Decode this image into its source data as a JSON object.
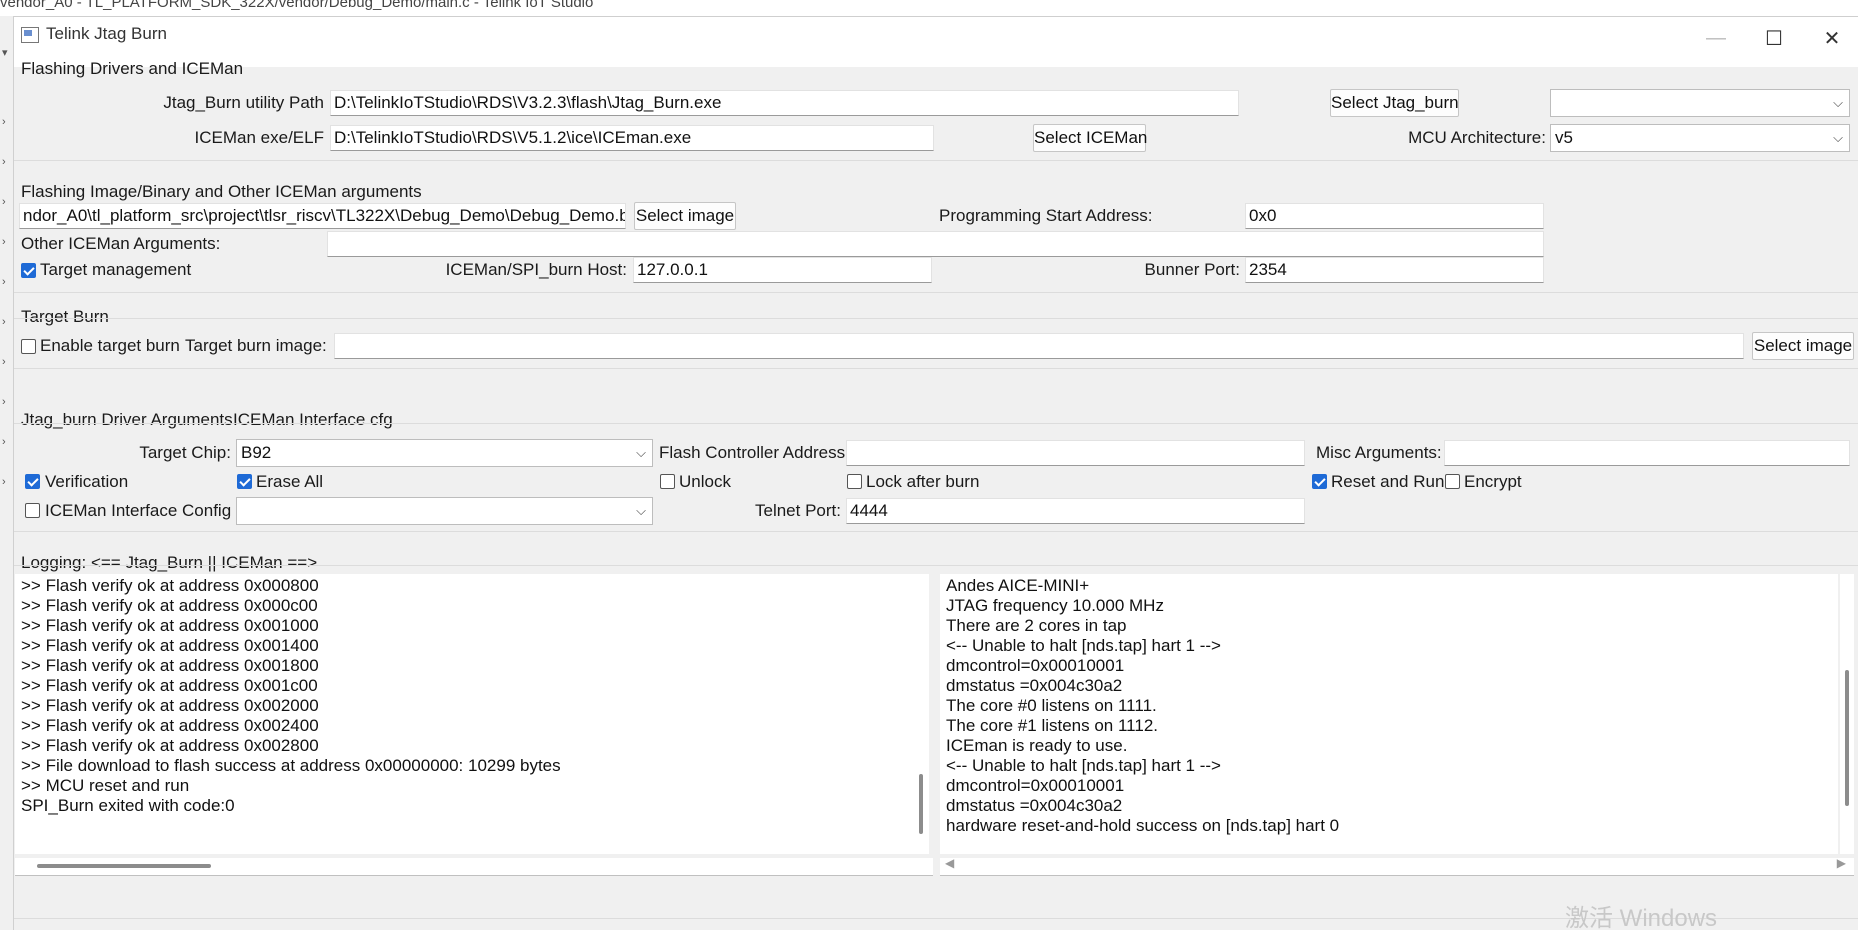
{
  "background_path": "vendor_A0 - TL_PLATFORM_SDK_322X/vendor/Debug_Demo/main.c - Telink IoT Studio",
  "window": {
    "title": "Telink Jtag Burn",
    "minimize_glyph": "—",
    "maximize_glyph": "☐",
    "close_glyph": "✕"
  },
  "flashing_drivers": {
    "section_title": "Flashing Drivers and ICEMan",
    "jtag_burn_path_label": "Jtag_Burn utility Path",
    "jtag_burn_path_value": "D:\\TelinkIoTStudio\\RDS\\V3.2.3\\flash\\Jtag_Burn.exe",
    "select_jtag_burn_label": "Select Jtag_burn",
    "top_right_combo_value": "",
    "iceman_label": "ICEMan exe/ELF",
    "iceman_value": "D:\\TelinkIoTStudio\\RDS\\V5.1.2\\ice\\ICEman.exe",
    "select_iceman_label": "Select ICEMan",
    "mcu_arch_label": "MCU Architecture:",
    "mcu_arch_value": "v5"
  },
  "flashing_image": {
    "section_title": "Flashing Image/Binary and Other ICEMan arguments",
    "image_path_value": "ndor_A0\\tl_platform_src\\project\\tlsr_riscv\\TL322X\\Debug_Demo\\Debug_Demo.bin",
    "select_image_label": "Select image",
    "start_address_label": "Programming Start Address:",
    "start_address_value": "0x0",
    "other_args_label": "Other ICEMan Arguments:",
    "other_args_value": "",
    "target_management_label": "Target management",
    "target_management_checked": true,
    "host_label": "ICEMan/SPI_burn Host:",
    "host_value": "127.0.0.1",
    "port_label": "Bunner Port:",
    "port_value": "2354"
  },
  "target_burn": {
    "section_title": "Target Burn",
    "enable_label": "Enable target burn",
    "enable_checked": false,
    "image_label": "Target burn image:",
    "image_value": "",
    "select_image_label": "Select image"
  },
  "driver_args": {
    "tab_jtag": "Jtag_burn Driver Arguments",
    "tab_iceman": "ICEMan Interface cfg",
    "target_chip_label": "Target Chip:",
    "target_chip_value": "B92",
    "flash_ctrl_label": "Flash Controller Address:",
    "flash_ctrl_value": "",
    "misc_label": "Misc Arguments:",
    "misc_value": "",
    "verification_label": "Verification",
    "erase_all_label": "Erase All",
    "unlock_label": "Unlock",
    "lock_after_label": "Lock after burn",
    "reset_run_label": "Reset and Run",
    "encrypt_label": "Encrypt",
    "iceman_cfg_label": "ICEMan Interface Config :",
    "iceman_cfg_value": "",
    "telnet_label": "Telnet Port:",
    "telnet_value": "4444",
    "checks": {
      "verification": true,
      "erase_all": true,
      "unlock": false,
      "lock_after": false,
      "reset_run": true,
      "encrypt": false,
      "iceman_cfg": false
    }
  },
  "logging": {
    "title": "Logging: <== Jtag_Burn || ICEMan ==>",
    "left_lines": [
      ">> Flash verify ok at address 0x000800",
      ">> Flash verify ok at address 0x000c00",
      ">> Flash verify ok at address 0x001000",
      ">> Flash verify ok at address 0x001400",
      ">> Flash verify ok at address 0x001800",
      ">> Flash verify ok at address 0x001c00",
      ">> Flash verify ok at address 0x002000",
      ">> Flash verify ok at address 0x002400",
      ">> Flash verify ok at address 0x002800",
      ">> File download to flash success at address 0x00000000: 10299 bytes",
      ">> MCU reset and run",
      "SPI_Burn exited with code:0"
    ],
    "right_lines": [
      "Andes AICE-MINI+",
      "JTAG frequency 10.000 MHz",
      "There are 2 cores in tap",
      "<-- Unable to halt [nds.tap] hart 1 -->",
      "  dmcontrol=0x00010001",
      "  dmstatus =0x004c30a2",
      "The core #0 listens on 1111.",
      "The core #1 listens on 1112.",
      "ICEman is ready to use.",
      "<-- Unable to halt [nds.tap] hart 1 -->",
      "  dmcontrol=0x00010001",
      "  dmstatus =0x004c30a2",
      "hardware reset-and-hold success on [nds.tap] hart 0"
    ]
  },
  "watermark": "激活 Windows",
  "colors": {
    "accent": "#1e6ad6",
    "window_bg": "#f0f0f0",
    "field_bg": "#ffffff"
  }
}
